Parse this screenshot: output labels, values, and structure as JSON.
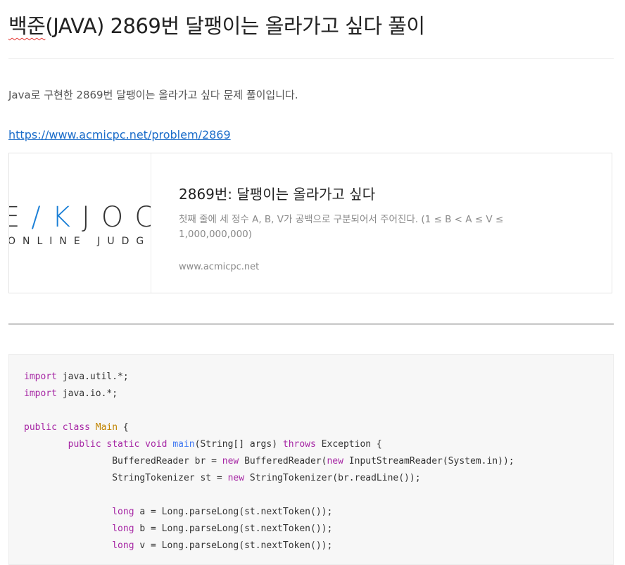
{
  "post": {
    "title_prefix": "백준",
    "title_rest": "(JAVA) 2869번 달팽이는 올라가고 싶다 풀이",
    "intro": "Java로 구현한 2869번 달팽이는 올라가고 싶다 문제 풀이입니다.",
    "link": "https://www.acmicpc.net/problem/2869"
  },
  "card": {
    "thumb_logo_a": "E",
    "thumb_logo_k": "/K",
    "thumb_logo_b": "JOC",
    "thumb_sub": "ONLINE JUDGE",
    "title": "2869번: 달팽이는 올라가고 싶다",
    "description": "첫째 줄에 세 정수 A, B, V가 공백으로 구분되어서 주어진다. (1 ≤ B < A ≤ V ≤ 1,000,000,000)",
    "host": "www.acmicpc.net"
  },
  "code": {
    "l1_kw": "import",
    "l1_rest": " java.util.*;",
    "l2_kw": "import",
    "l2_rest": " java.io.*;",
    "l4_kw": "public class",
    "l4_cls": " Main",
    "l4_rest": " {",
    "l5_kw": "        public static void",
    "l5_fn": " main",
    "l5_mid": "(String[] args) ",
    "l5_kw2": "throws",
    "l5_rest": " Exception {",
    "l6_a": "                BufferedReader br = ",
    "l6_kw": "new",
    "l6_b": " BufferedReader(",
    "l6_kw2": "new",
    "l6_c": " InputStreamReader(System.in));",
    "l7_a": "                StringTokenizer st = ",
    "l7_kw": "new",
    "l7_b": " StringTokenizer(br.readLine());",
    "l9_kw": "                long",
    "l9_rest": " a = Long.parseLong(st.nextToken());",
    "l10_kw": "                long",
    "l10_rest": " b = Long.parseLong(st.nextToken());",
    "l11_kw": "                long",
    "l11_rest": " v = Long.parseLong(st.nextToken());"
  }
}
